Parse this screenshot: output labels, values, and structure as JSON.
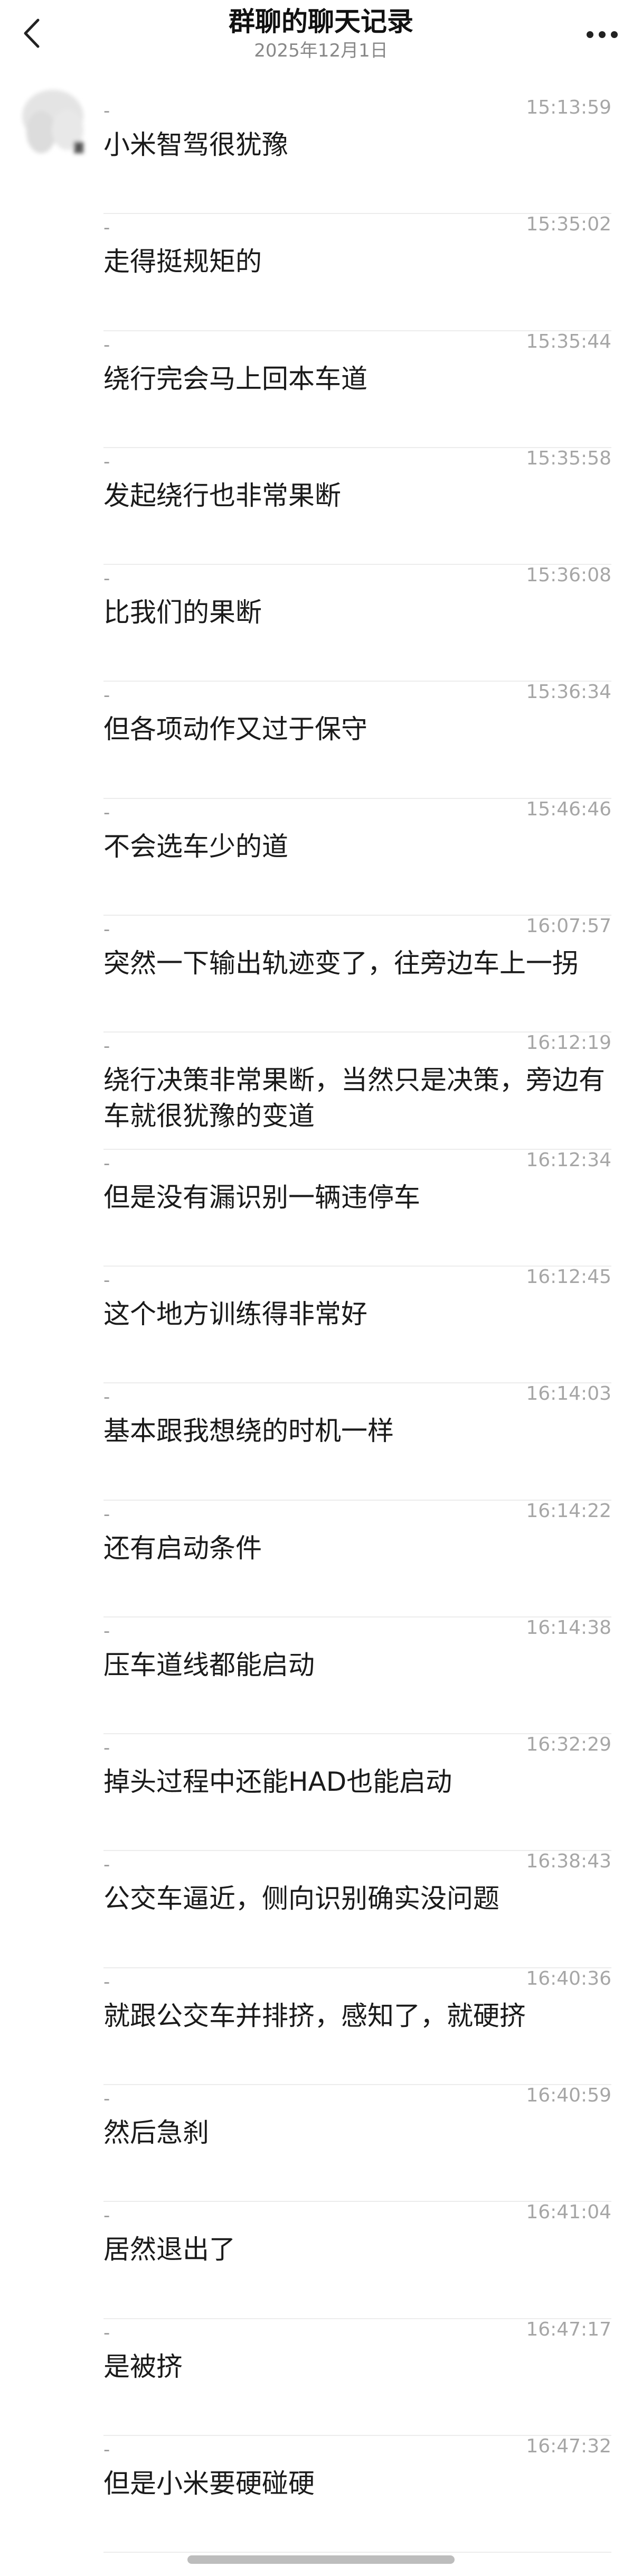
{
  "header": {
    "title": "群聊的聊天记录",
    "date": "2025年12月1日",
    "back_icon": "chevron-left-icon",
    "more_icon": "more-dots-icon"
  },
  "messages": [
    {
      "sender": "-",
      "time": "15:13:59",
      "text": "小米智驾很犹豫"
    },
    {
      "sender": "-",
      "time": "15:35:02",
      "text": "走得挺规矩的"
    },
    {
      "sender": "-",
      "time": "15:35:44",
      "text": "绕行完会马上回本车道"
    },
    {
      "sender": "-",
      "time": "15:35:58",
      "text": "发起绕行也非常果断"
    },
    {
      "sender": "-",
      "time": "15:36:08",
      "text": "比我们的果断"
    },
    {
      "sender": "-",
      "time": "15:36:34",
      "text": "但各项动作又过于保守"
    },
    {
      "sender": "-",
      "time": "15:46:46",
      "text": "不会选车少的道"
    },
    {
      "sender": "-",
      "time": "16:07:57",
      "text": "突然一下输出轨迹变了，往旁边车上一拐"
    },
    {
      "sender": "-",
      "time": "16:12:19",
      "text": "绕行决策非常果断，当然只是决策，旁边有车就很犹豫的变道"
    },
    {
      "sender": "-",
      "time": "16:12:34",
      "text": "但是没有漏识别一辆违停车"
    },
    {
      "sender": "-",
      "time": "16:12:45",
      "text": "这个地方训练得非常好"
    },
    {
      "sender": "-",
      "time": "16:14:03",
      "text": "基本跟我想绕的时机一样"
    },
    {
      "sender": "-",
      "time": "16:14:22",
      "text": "还有启动条件"
    },
    {
      "sender": "-",
      "time": "16:14:38",
      "text": "压车道线都能启动"
    },
    {
      "sender": "-",
      "time": "16:32:29",
      "text": "掉头过程中还能HAD也能启动"
    },
    {
      "sender": "-",
      "time": "16:38:43",
      "text": "公交车逼近，侧向识别确实没问题"
    },
    {
      "sender": "-",
      "time": "16:40:36",
      "text": "就跟公交车并排挤，感知了，就硬挤"
    },
    {
      "sender": "-",
      "time": "16:40:59",
      "text": "然后急刹"
    },
    {
      "sender": "-",
      "time": "16:41:04",
      "text": "居然退出了"
    },
    {
      "sender": "-",
      "time": "16:47:17",
      "text": "是被挤"
    },
    {
      "sender": "-",
      "time": "16:47:32",
      "text": "但是小米要硬碰硬"
    }
  ]
}
